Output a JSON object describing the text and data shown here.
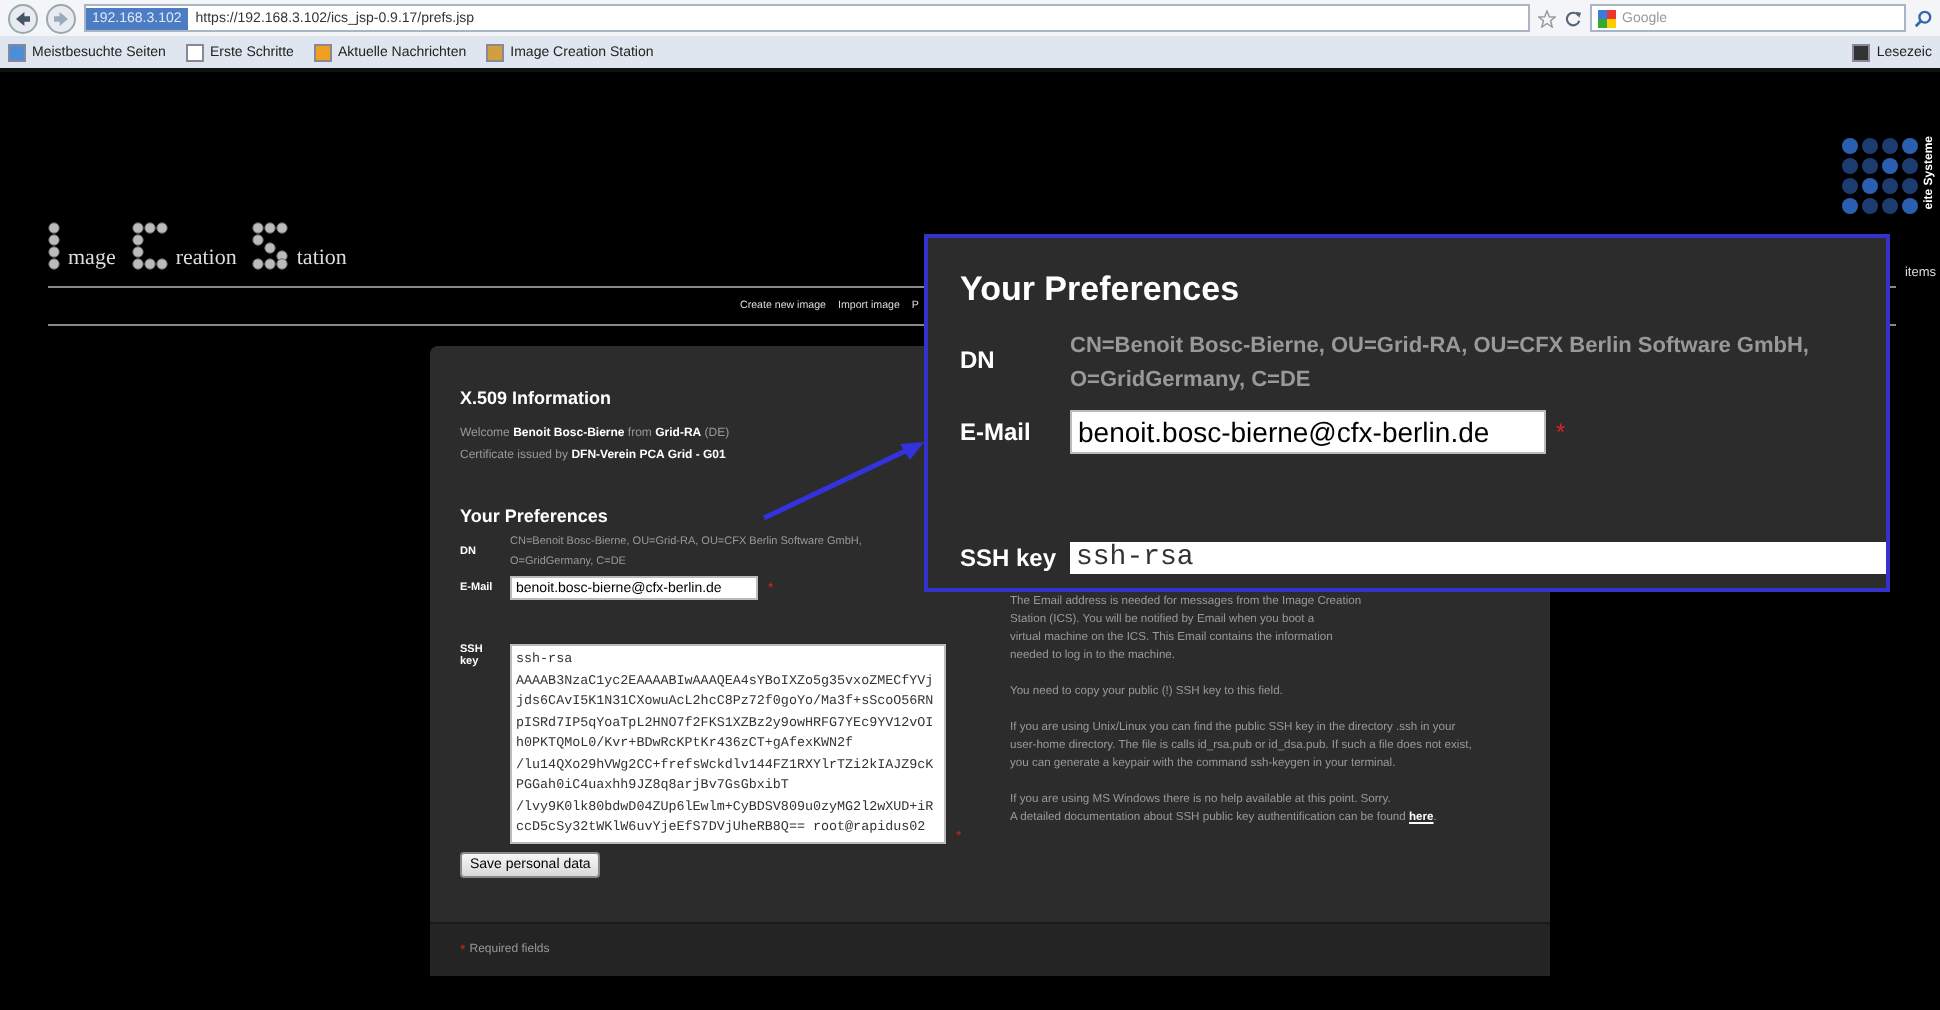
{
  "browser": {
    "site_badge": "192.168.3.102",
    "url": "https://192.168.3.102/ics_jsp-0.9.17/prefs.jsp",
    "search_placeholder": "Google",
    "bookmarks": [
      "Meistbesuchte Seiten",
      "Erste Schritte",
      "Aktuelle Nachrichten",
      "Image Creation Station"
    ],
    "bookmarks_menu": "Lesezeic"
  },
  "logo": {
    "words": [
      "mage",
      "reation",
      "tation"
    ]
  },
  "partner_logo": {
    "vertical_text": "eite Systeme",
    "text": "items"
  },
  "nav": [
    "Create new image",
    "Import image",
    "P"
  ],
  "x509": {
    "title": "X.509 Information",
    "welcome": "Welcome **Benoit Bosc-Bierne** from **Grid-RA** (DE)",
    "issued": "Certificate issued by **DFN-Verein PCA Grid - G01**"
  },
  "preferences": {
    "title": "Your Preferences",
    "dn_label": "DN",
    "dn": "CN=Benoit Bosc-Bierne, OU=Grid-RA, OU=CFX Berlin Software GmbH, O=GridGermany, C=DE",
    "email_label": "E-Mail",
    "email": "benoit.bosc-bierne@cfx-berlin.de",
    "required_mark": "*",
    "ssh_label": "SSH key",
    "ssh_key": "ssh-rsa\nAAAAB3NzaC1yc2EAAAABIwAAAQEA4sYBoIXZo5g35vxoZMECfYVj\njds6CAvI5K1N31CXowuAcL2hcC8Pz72f0goYo/Ma3f+sScoO56RN\npISRd7IP5qYoaTpL2HNO7f2FKS1XZBz2y9owHRFG7YEc9YV12vOI\nh0PKTQMoL0/Kvr+BDwRcKPtKr436zCT+gAfexKWN2f\n/lu14QXo29hVWg2CC+frefsWckdlv144FZ1RXYlrTZi2kIAJZ9cK\nPGGah0iC4uaxhh9JZ8q8arjBv7GsGbxibT\n/lvy9K0lk80bdwD04ZUp6lEwlm+CyBDSV809u0zyMG2l2wXUD+iR\nccD5cSy32tWKlW6uvYjeEfS7DVjUheRB8Q== root@rapidus02",
    "ssh_required_mark": "*",
    "save_button": "Save personal data"
  },
  "help": [
    [
      "The Email address is needed for messages from the Image Creation",
      "Station (ICS). You will be notified by Email when you boot a",
      "virtual machine on the ICS. This Email contains the information",
      "needed to log in to the machine."
    ],
    [
      "You need to copy your public (!) SSH key to this field."
    ],
    [
      "If you are using Unix/Linux you can find the public SSH key in the directory .ssh in your",
      "user-home directory. The file is calls id_rsa.pub or id_dsa.pub. If such a file does not exist,",
      "you can generate a keypair with the command ssh-keygen in your terminal."
    ],
    [
      "If you are using MS Windows there is no help available at this point. Sorry.",
      "A detailed documentation about SSH public key authentification can be found"
    ]
  ],
  "help_link": "here",
  "help_end": ".",
  "footer": {
    "mark": "*",
    "text": "Required fields"
  },
  "zoom": {
    "title": "Your Preferences",
    "dn_label": "DN",
    "dn": "CN=Benoit Bosc-Bierne, OU=Grid-RA, OU=CFX Berlin Software GmbH, O=GridGermany, C=DE",
    "email_label": "E-Mail",
    "email": "benoit.bosc-bierne@cfx-berlin.de",
    "required_mark": "*",
    "ssh_label": "SSH key",
    "ssh_value": "ssh-rsa"
  }
}
